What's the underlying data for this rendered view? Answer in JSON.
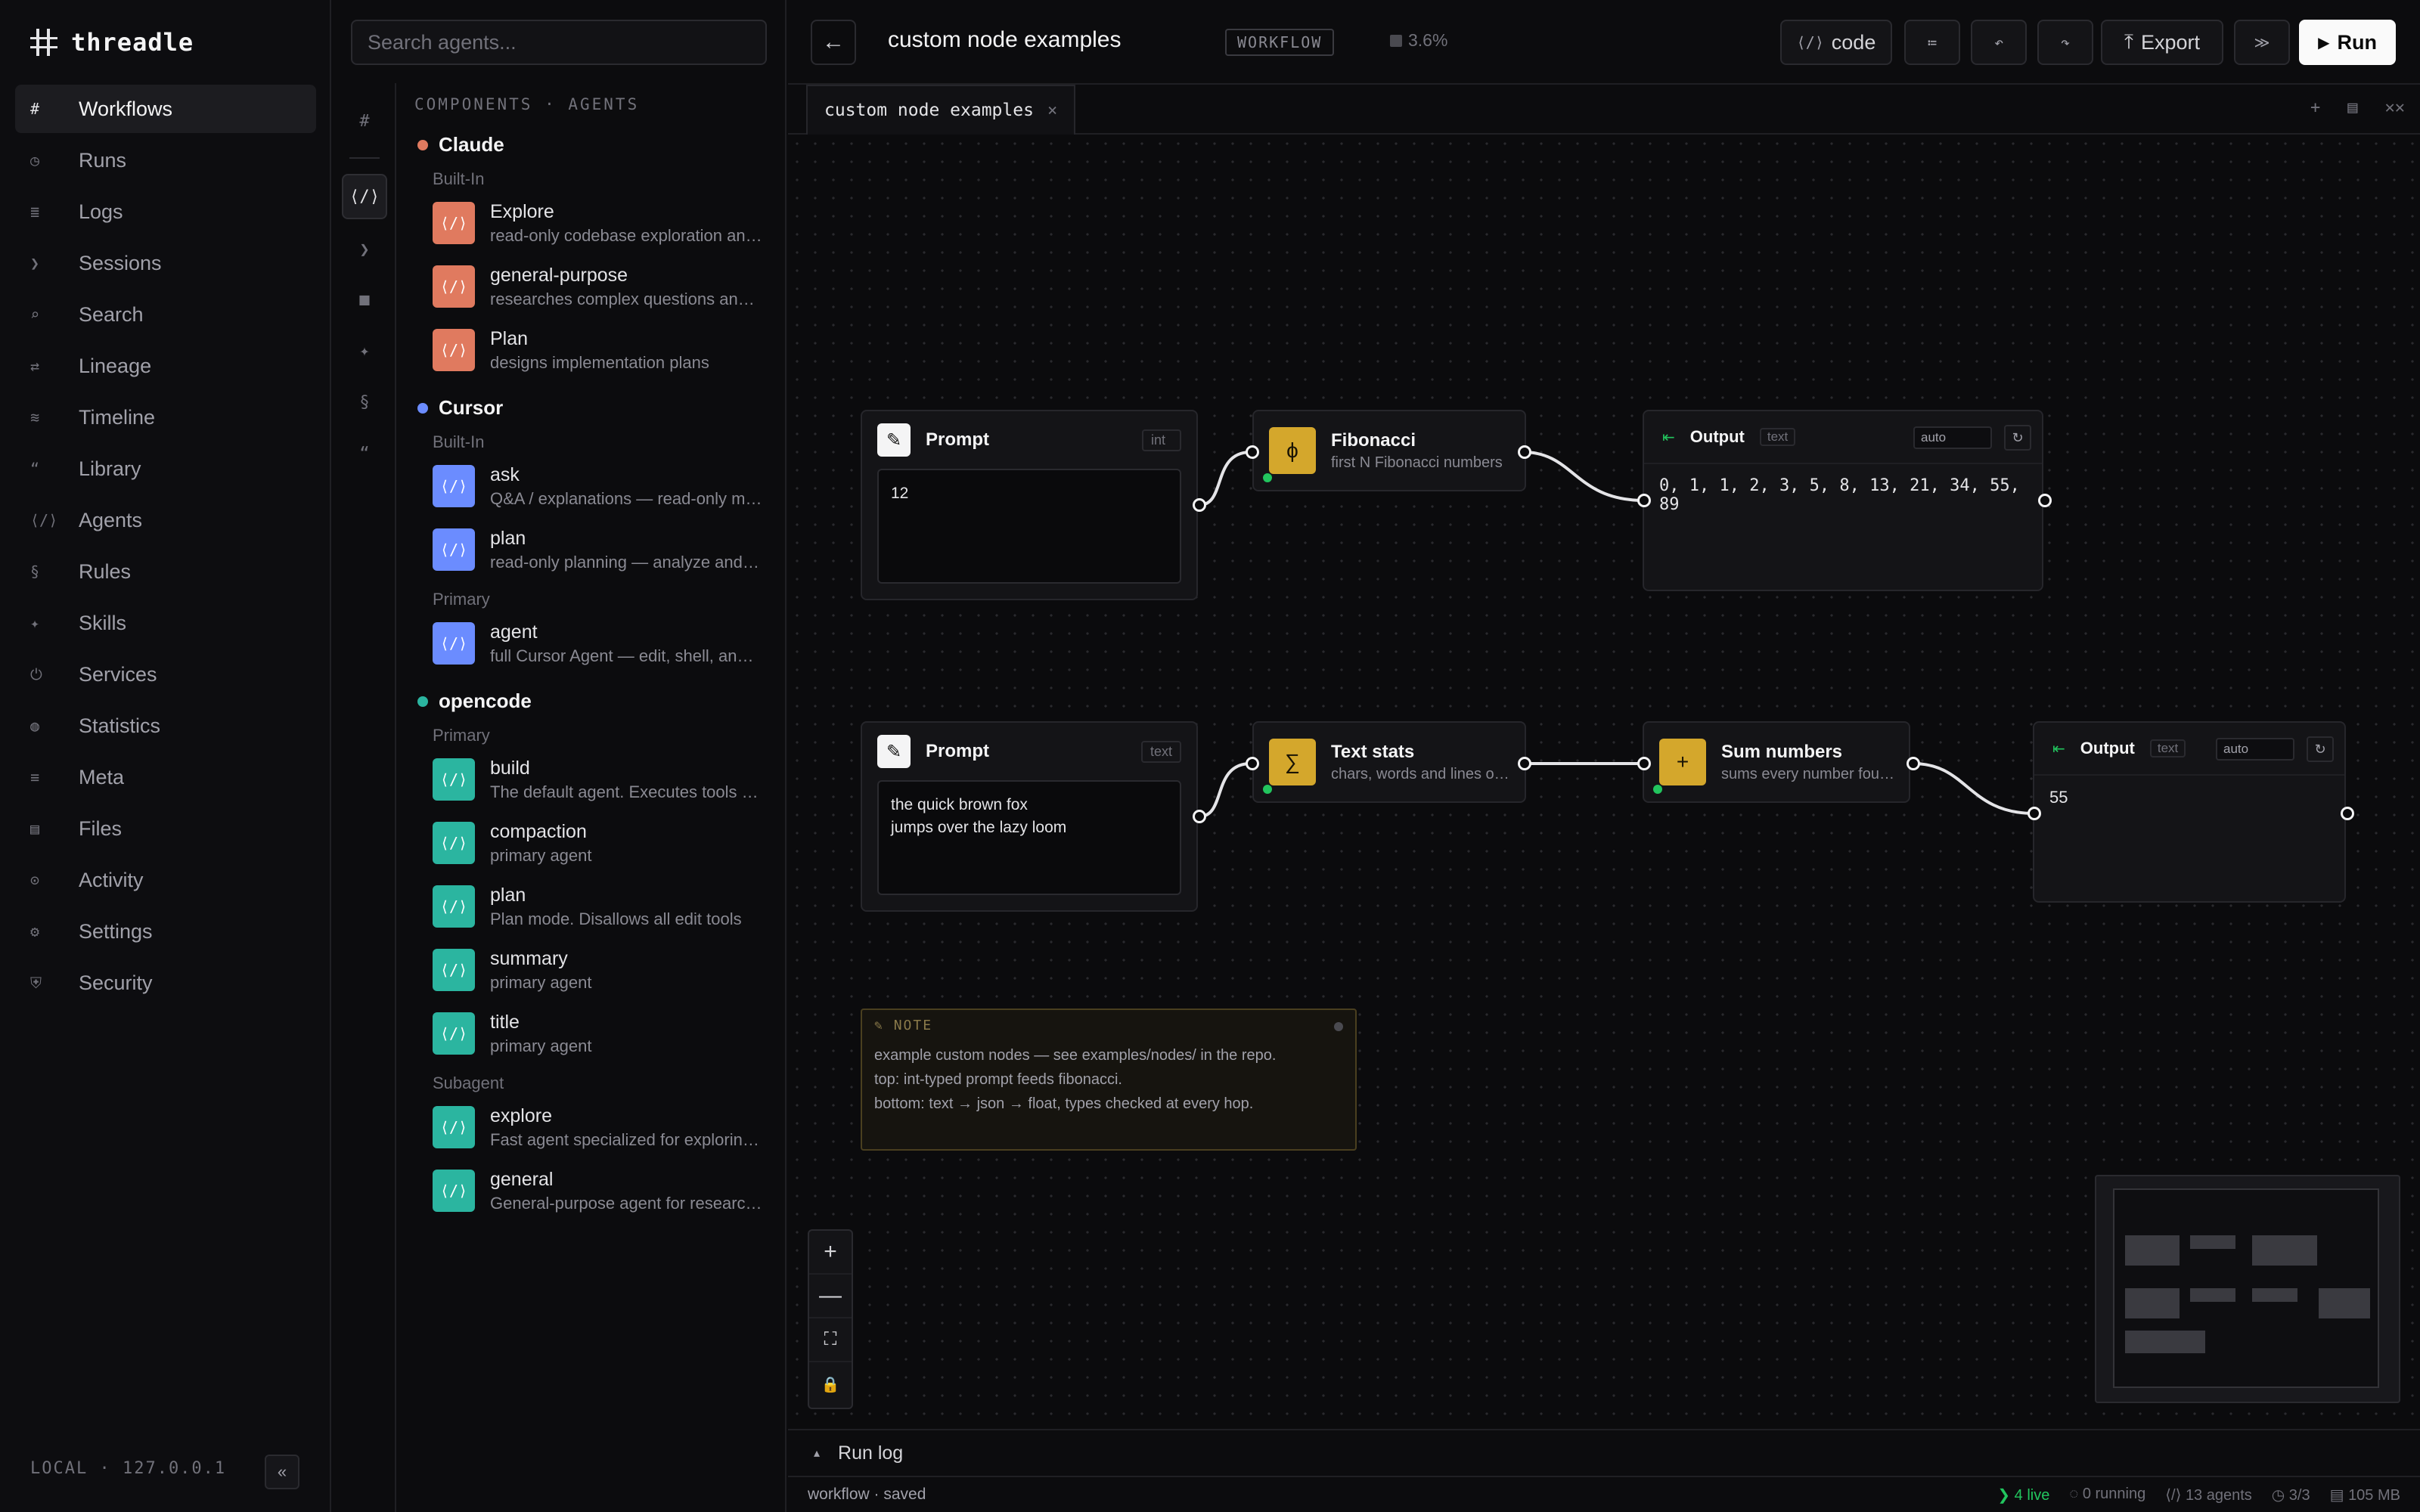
{
  "app": {
    "name": "threadle"
  },
  "nav": {
    "items": [
      {
        "icon": "#",
        "label": "Workflows",
        "active": true
      },
      {
        "icon": "◷",
        "label": "Runs"
      },
      {
        "icon": "≣",
        "label": "Logs"
      },
      {
        "icon": "❯",
        "label": "Sessions"
      },
      {
        "icon": "⌕",
        "label": "Search"
      },
      {
        "icon": "⇄",
        "label": "Lineage"
      },
      {
        "icon": "≋",
        "label": "Timeline"
      },
      {
        "icon": "“",
        "label": "Library"
      },
      {
        "icon": "⟨/⟩",
        "label": "Agents"
      },
      {
        "icon": "§",
        "label": "Rules"
      },
      {
        "icon": "✦",
        "label": "Skills"
      },
      {
        "icon": "⏻",
        "label": "Services"
      },
      {
        "icon": "◍",
        "label": "Statistics"
      },
      {
        "icon": "≡",
        "label": "Meta"
      },
      {
        "icon": "▤",
        "label": "Files"
      },
      {
        "icon": "⊙",
        "label": "Activity"
      },
      {
        "icon": "⚙",
        "label": "Settings"
      },
      {
        "icon": "⛨",
        "label": "Security"
      }
    ],
    "footer": "LOCAL · 127.0.0.1",
    "collapse": "«"
  },
  "agents_panel": {
    "search_placeholder": "Search agents...",
    "header": "COMPONENTS · AGENTS",
    "rail": [
      "#",
      "⟨/⟩",
      "❯",
      "■",
      "✦",
      "§",
      "“"
    ],
    "providers": [
      {
        "name": "Claude",
        "color": "#e07a5f",
        "groups": [
          {
            "label": "Built-In",
            "agents": [
              {
                "name": "Explore",
                "desc": "read-only codebase exploration and search"
              },
              {
                "name": "general-purpose",
                "desc": "researches complex questions and multi-step tasks"
              },
              {
                "name": "Plan",
                "desc": "designs implementation plans"
              }
            ]
          }
        ]
      },
      {
        "name": "Cursor",
        "color": "#6b8cff",
        "groups": [
          {
            "label": "Built-In",
            "agents": [
              {
                "name": "ask",
                "desc": "Q&A / explanations — read-only mode"
              },
              {
                "name": "plan",
                "desc": "read-only planning — analyze and propose"
              }
            ]
          },
          {
            "label": "Primary",
            "agents": [
              {
                "name": "agent",
                "desc": "full Cursor Agent — edit, shell, and tools"
              }
            ]
          }
        ]
      },
      {
        "name": "opencode",
        "color": "#2bb5a0",
        "groups": [
          {
            "label": "Primary",
            "agents": [
              {
                "name": "build",
                "desc": "The default agent. Executes tools based on permissions"
              },
              {
                "name": "compaction",
                "desc": "primary agent"
              },
              {
                "name": "plan",
                "desc": "Plan mode. Disallows all edit tools"
              },
              {
                "name": "summary",
                "desc": "primary agent"
              },
              {
                "name": "title",
                "desc": "primary agent"
              }
            ]
          },
          {
            "label": "Subagent",
            "agents": [
              {
                "name": "explore",
                "desc": "Fast agent specialized for exploring codebases"
              },
              {
                "name": "general",
                "desc": "General-purpose agent for researching tasks"
              }
            ]
          }
        ]
      }
    ]
  },
  "topbar": {
    "back": "←",
    "title": "custom node examples",
    "badge": "WORKFLOW",
    "percent": "3.6%",
    "code_label": "code",
    "code_icon": "⟨/⟩",
    "list_icon": "≔",
    "undo_icon": "↶",
    "redo_icon": "↷",
    "export_label": "Export",
    "export_icon": "⤒",
    "more_icon": "≫",
    "run_label": "Run",
    "run_icon": "▶"
  },
  "tabs": [
    {
      "label": "custom node examples",
      "close": "×"
    }
  ],
  "tab_actions": [
    "+",
    "▤",
    "✕✕"
  ],
  "nodes": {
    "prompt1": {
      "title": "Prompt",
      "type": "int",
      "value": "12"
    },
    "fib": {
      "title": "Fibonacci",
      "sub": "first N Fibonacci numbers",
      "icon": "ϕ"
    },
    "out1": {
      "title": "Output",
      "tag": "text",
      "mode": "auto",
      "value": "0, 1, 1, 2, 3, 5, 8, 13, 21, 34, 55, 89"
    },
    "prompt2": {
      "title": "Prompt",
      "type": "text",
      "value": "the quick brown fox\njumps over the lazy loom"
    },
    "stats": {
      "title": "Text stats",
      "sub": "chars, words and lines of text",
      "icon": "∑"
    },
    "sum": {
      "title": "Sum numbers",
      "sub": "sums every number found",
      "icon": "+"
    },
    "out2": {
      "title": "Output",
      "tag": "text",
      "mode": "auto",
      "value": "55"
    }
  },
  "note": {
    "label": "NOTE",
    "lines": [
      "example custom nodes — see examples/nodes/ in the repo.",
      "top: int-typed prompt feeds fibonacci.",
      "bottom: text → json → float, types checked at every hop."
    ]
  },
  "zoom": [
    "+",
    "—",
    "⛶",
    "🔒"
  ],
  "runlog": {
    "icon": "▴",
    "label": "Run log"
  },
  "status": {
    "left": "workflow · saved",
    "live": "❯ 4 live",
    "running": "◌ 0 running",
    "agents": "⟨/⟩ 13 agents",
    "count": "◷ 3/3",
    "memory": "▤ 105 MB"
  },
  "colors": {
    "accent_yellow": "#d4a72c",
    "live_green": "#22c55e"
  }
}
